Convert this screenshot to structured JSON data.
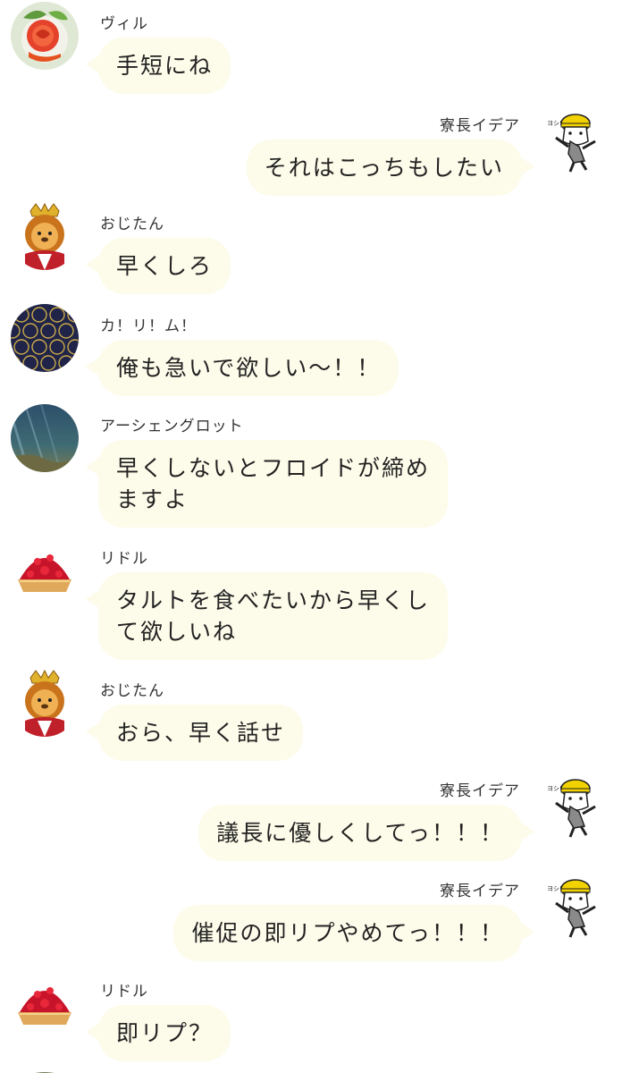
{
  "messages": [
    {
      "side": "left",
      "name": "ヴィル",
      "text": "手短にね",
      "avatar": "rose-avatar"
    },
    {
      "side": "right",
      "name": "寮長イデア",
      "text": "それはこっちもしたい",
      "avatar": "cat-helmet-avatar"
    },
    {
      "side": "left",
      "name": "おじたん",
      "text": "早くしろ",
      "avatar": "lion-king-avatar"
    },
    {
      "side": "left",
      "name": "カ！リ！ム！",
      "text": "俺も急いで欲しい〜！！",
      "avatar": "pattern-avatar"
    },
    {
      "side": "left",
      "name": "アーシェングロット",
      "text_lines": [
        "早くしないとフロイドが締め",
        "ますよ"
      ],
      "avatar": "sea-avatar"
    },
    {
      "side": "left",
      "name": "リドル",
      "text_lines": [
        "タルトを食べたいから早くし",
        "て欲しいね"
      ],
      "avatar": "strawberry-tart-avatar"
    },
    {
      "side": "left",
      "name": "おじたん",
      "text": "おら、早く話せ",
      "avatar": "lion-king-avatar"
    },
    {
      "side": "right",
      "name": "寮長イデア",
      "text": "議長に優しくしてっ！！！",
      "avatar": "cat-helmet-avatar"
    },
    {
      "side": "right",
      "name": "寮長イデア",
      "text": "催促の即リプやめてっ！！！",
      "avatar": "cat-helmet-avatar"
    },
    {
      "side": "left",
      "name": "リドル",
      "text": "即リプ？",
      "avatar": "strawberry-tart-avatar"
    }
  ],
  "colors": {
    "bubble": "#fdfbe9",
    "name_text": "#333333",
    "message_text": "#222222"
  }
}
